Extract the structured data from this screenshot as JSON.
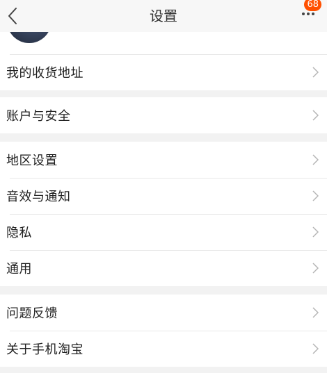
{
  "header": {
    "title": "设置",
    "badge_count": "68",
    "back_icon": "chevron-left-icon",
    "more_icon": "more-dots-icon"
  },
  "groups": [
    {
      "items": [
        {
          "label": "我的收货地址"
        }
      ]
    },
    {
      "items": [
        {
          "label": "账户与安全"
        }
      ]
    },
    {
      "items": [
        {
          "label": "地区设置"
        },
        {
          "label": "音效与通知"
        },
        {
          "label": "隐私"
        },
        {
          "label": "通用"
        }
      ]
    },
    {
      "items": [
        {
          "label": "问题反馈"
        },
        {
          "label": "关于手机淘宝"
        }
      ]
    }
  ],
  "colors": {
    "badge": "#ff5000",
    "background": "#f2f2f2",
    "divider": "#e8e8e8"
  }
}
